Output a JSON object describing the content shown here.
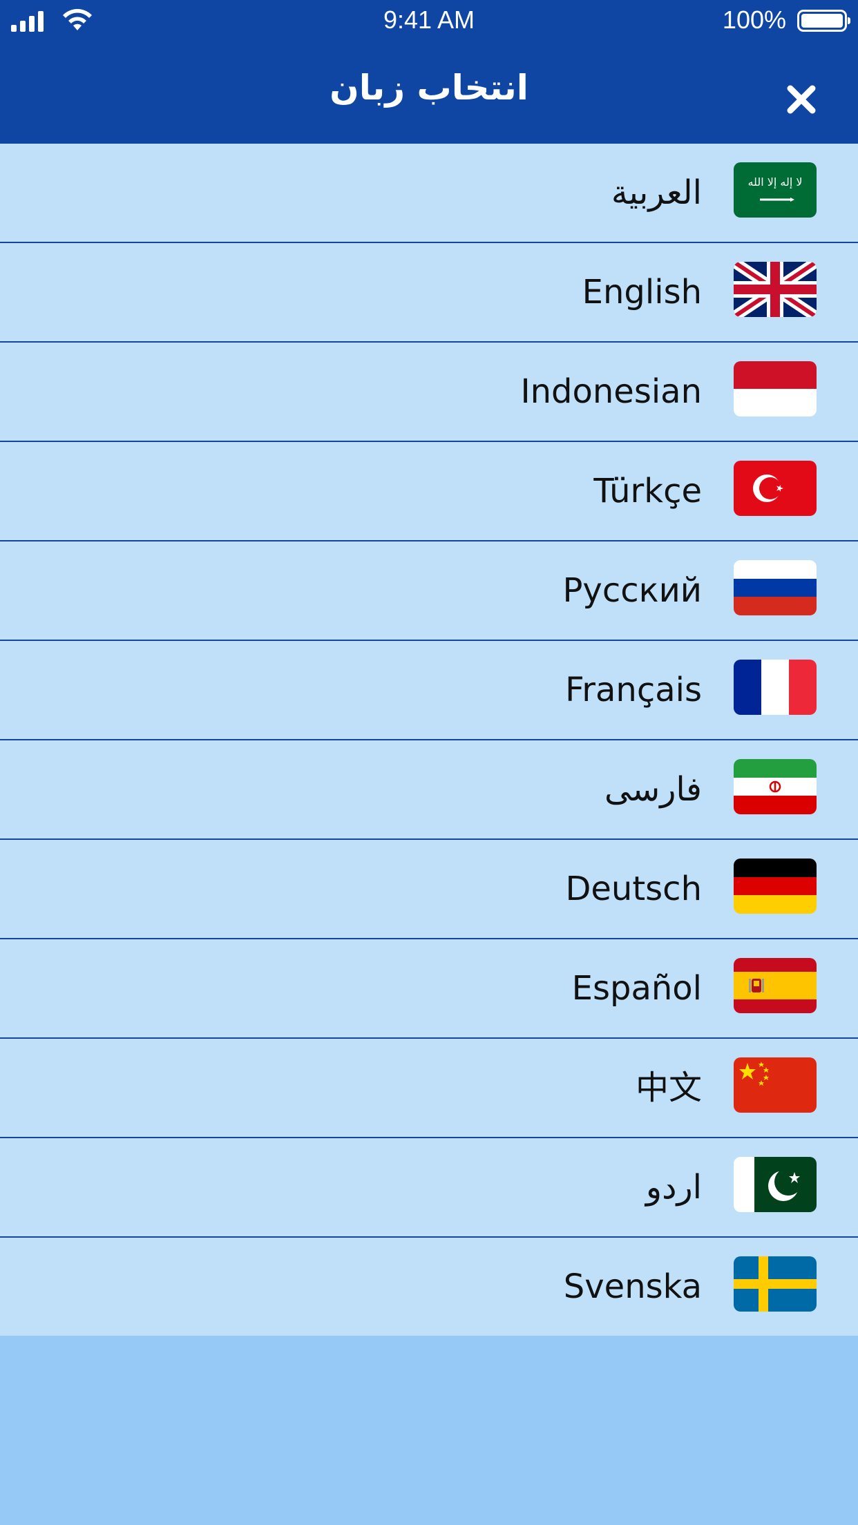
{
  "status_bar": {
    "time": "9:41 AM",
    "battery_percent": "100%",
    "signal_icon": "cellular-signal-icon",
    "wifi_icon": "wifi-icon",
    "battery_icon": "battery-icon"
  },
  "header": {
    "title": "انتخاب زبان",
    "close_icon": "close-icon",
    "background_color": "#0f46a3"
  },
  "languages": [
    {
      "label": "العربية",
      "flag": "saudi-arabia-flag-icon"
    },
    {
      "label": "English",
      "flag": "united-kingdom-flag-icon"
    },
    {
      "label": "Indonesian",
      "flag": "indonesia-flag-icon"
    },
    {
      "label": "Türkçe",
      "flag": "turkey-flag-icon"
    },
    {
      "label": "Русский",
      "flag": "russia-flag-icon"
    },
    {
      "label": "Français",
      "flag": "france-flag-icon"
    },
    {
      "label": "فارسی",
      "flag": "iran-flag-icon"
    },
    {
      "label": "Deutsch",
      "flag": "germany-flag-icon"
    },
    {
      "label": "Español",
      "flag": "spain-flag-icon"
    },
    {
      "label": "中文",
      "flag": "china-flag-icon"
    },
    {
      "label": "اردو",
      "flag": "pakistan-flag-icon"
    },
    {
      "label": "Svenska",
      "flag": "sweden-flag-icon"
    }
  ],
  "colors": {
    "row_background": "#bfe0f8",
    "row_divider": "#1345a0",
    "page_background": "#97c9f6"
  }
}
